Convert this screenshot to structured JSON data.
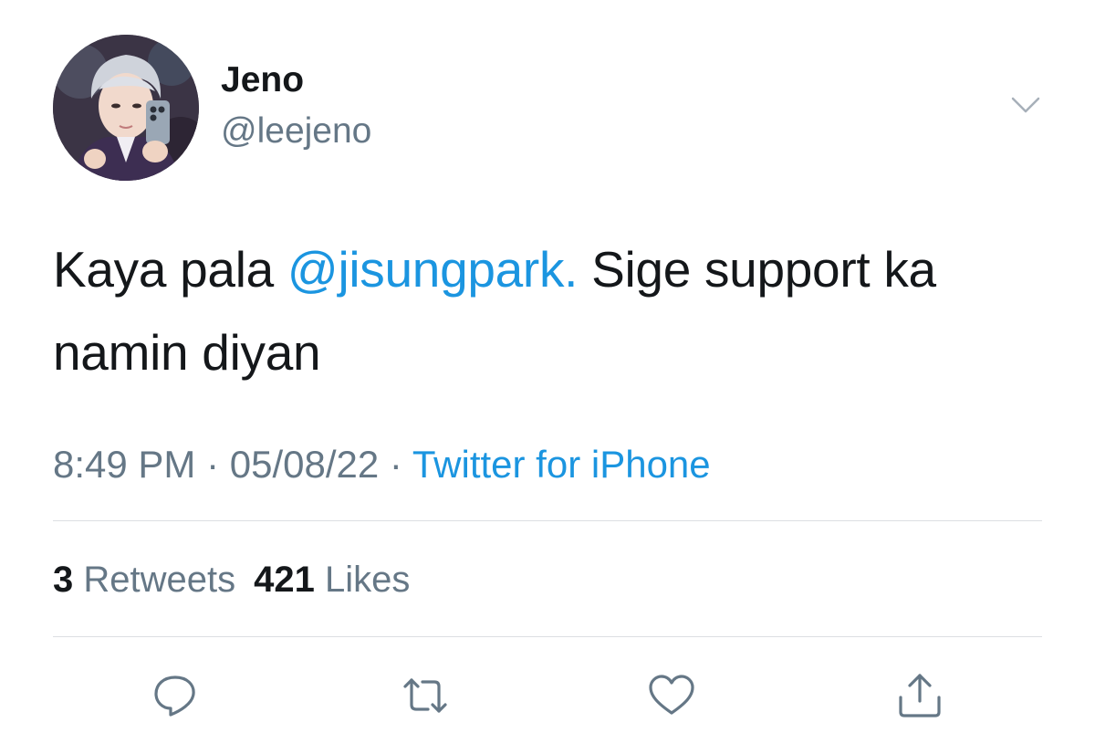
{
  "author": {
    "display_name": "Jeno",
    "handle": "@leejeno"
  },
  "tweet": {
    "text_before": "Kaya pala ",
    "mention": "@jisungpark.",
    "text_after": " Sige support ka namin diyan"
  },
  "meta": {
    "time": "8:49 PM",
    "separator": " · ",
    "date": "05/08/22",
    "source": "Twitter for iPhone"
  },
  "stats": {
    "retweets_count": "3",
    "retweets_label": " Retweets",
    "likes_count": "421",
    "likes_label": " Likes"
  },
  "icons": {
    "menu": "chevron-down-icon",
    "reply": "reply-icon",
    "retweet": "retweet-icon",
    "like": "heart-icon",
    "share": "share-icon"
  },
  "colors": {
    "link": "#1b95e0",
    "secondary_text": "#657786",
    "primary_text": "#14171a",
    "divider": "#dcdfe2"
  }
}
